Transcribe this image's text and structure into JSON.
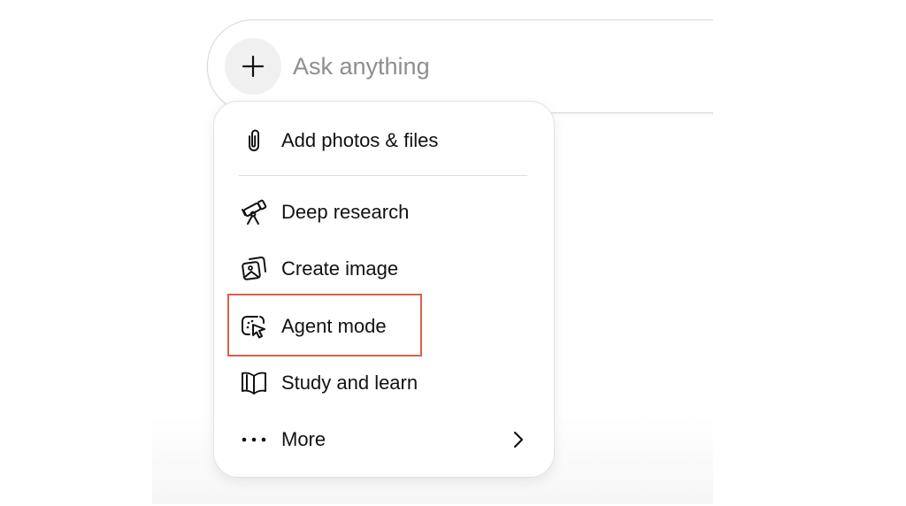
{
  "composer": {
    "placeholder": "Ask anything",
    "value": ""
  },
  "menu": {
    "items": [
      {
        "id": "add-photos-files",
        "label": "Add photos & files",
        "icon": "paperclip-icon"
      },
      {
        "id": "deep-research",
        "label": "Deep research",
        "icon": "telescope-icon"
      },
      {
        "id": "create-image",
        "label": "Create image",
        "icon": "image-icon"
      },
      {
        "id": "agent-mode",
        "label": "Agent mode",
        "icon": "agent-cursor-icon"
      },
      {
        "id": "study-and-learn",
        "label": "Study and learn",
        "icon": "book-icon"
      },
      {
        "id": "more",
        "label": "More",
        "icon": "more-dots-icon"
      }
    ]
  },
  "highlight": {
    "target": "agent-mode",
    "color": "#d9604c"
  },
  "colors": {
    "icon_stroke": "#111111",
    "plus_button_bg": "#f0f0f0",
    "placeholder": "#8e8e8e"
  }
}
